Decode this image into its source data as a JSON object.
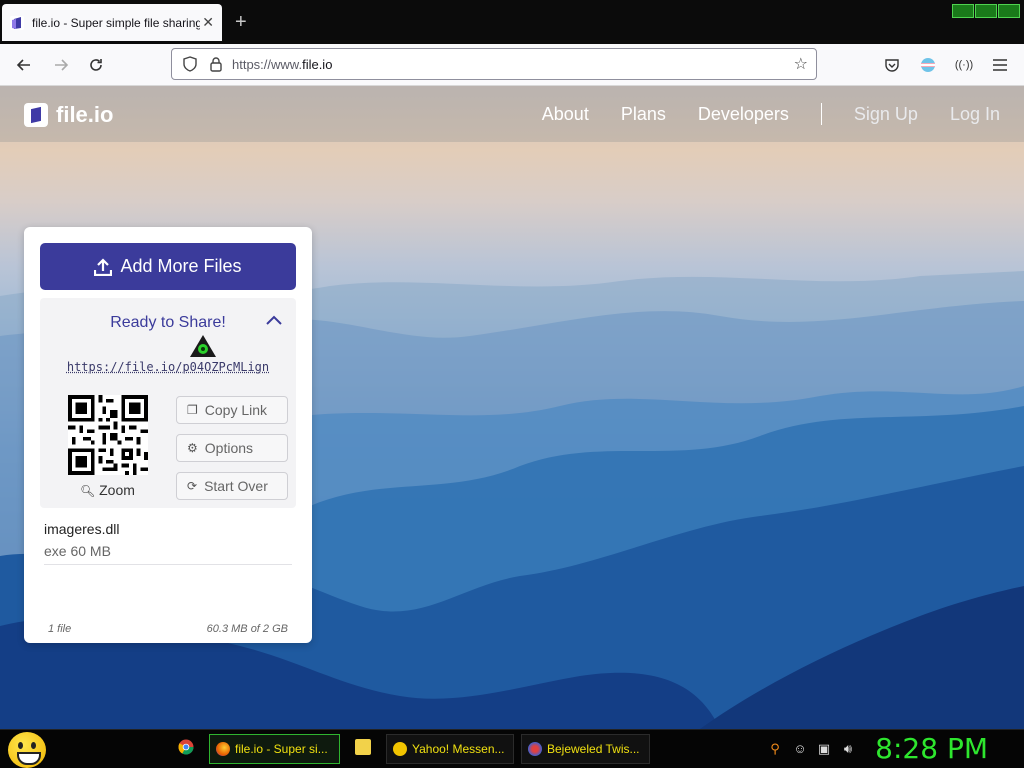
{
  "browser": {
    "tab_title": "file.io - Super simple file sharing",
    "new_tab_label": "+",
    "url_prefix": "https://www.",
    "url_domain": "file.io"
  },
  "site": {
    "logo_text": "file.io",
    "nav": [
      "About",
      "Plans",
      "Developers"
    ],
    "sign_up": "Sign Up",
    "log_in": "Log In"
  },
  "card": {
    "add_button": "Add More Files",
    "ready_label": "Ready to Share!",
    "share_link": "https://file.io/p04OZPcMLign",
    "zoom_label": "Zoom",
    "copy_label": "Copy Link",
    "options_label": "Options",
    "start_over_label": "Start Over",
    "file_name": "imageres.dll",
    "file_meta": "exe 60 MB",
    "file_count": "1 file",
    "usage": "60.3 MB of 2 GB"
  },
  "taskbar": {
    "items": [
      {
        "label": "file.io - Super si...",
        "icon": "firefox-icon",
        "color": "#e66000"
      },
      {
        "label": "Yahoo! Messen...",
        "icon": "yahoo-smiley-icon",
        "color": "#f2c400"
      },
      {
        "label": "Bejeweled Twis...",
        "icon": "bejeweled-icon",
        "color": "#4060d0"
      }
    ],
    "clock": "8:28 PM"
  },
  "colors": {
    "accent": "#3b3b9b",
    "clock": "#2ee62e",
    "taskbar_text": "#f0e010"
  }
}
